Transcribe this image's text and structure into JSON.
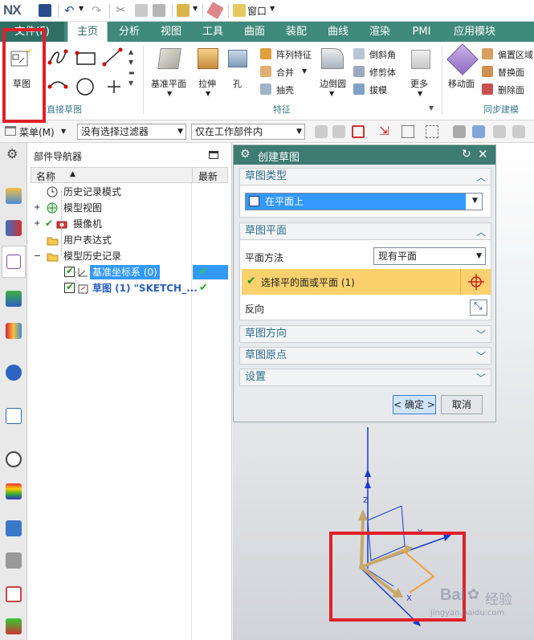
{
  "app": {
    "logo": "NX",
    "window_menu": "窗口"
  },
  "tabs": [
    "文件(F)",
    "主页",
    "分析",
    "视图",
    "工具",
    "曲面",
    "装配",
    "曲线",
    "渲染",
    "PMI",
    "应用模块"
  ],
  "ribbon": {
    "sketch": "草图",
    "direct_sketch_group": "直接草图",
    "datum_plane": "基准平面",
    "extrude": "拉伸",
    "hole": "孔",
    "pattern_feature": "阵列特征",
    "unite": "合并",
    "shell": "抽壳",
    "edge_blend": "边倒圆",
    "chamfer": "倒斜角",
    "trim_body": "修剪体",
    "draft": "拔模",
    "more": "更多",
    "feature_group": "特征",
    "move_face": "移动面",
    "offset_region": "偏置区域",
    "replace_face": "替换面",
    "delete_face": "删除面",
    "sync_group": "同步建模"
  },
  "cmdbar": {
    "menu": "菜单(M)",
    "filter": "没有选择过滤器",
    "scope": "仅在工作部件内"
  },
  "navigator": {
    "title": "部件导航器",
    "col_name": "名称",
    "col_latest": "最新",
    "rows": [
      {
        "label": "历史记录模式"
      },
      {
        "label": "模型视图"
      },
      {
        "label": "摄像机"
      },
      {
        "label": "用户表达式"
      },
      {
        "label": "模型历史记录"
      },
      {
        "label": "基准坐标系 (0)"
      },
      {
        "label": "草图 (1) \"SKETCH_..."
      }
    ]
  },
  "dialog": {
    "title": "创建草图",
    "sec_type": "草图类型",
    "type_value": "在平面上",
    "sec_plane": "草图平面",
    "plane_method_label": "平面方法",
    "plane_method_value": "现有平面",
    "select_plane": "选择平的面或平面 (1)",
    "reverse": "反向",
    "sec_orientation": "草图方向",
    "sec_origin": "草图原点",
    "sec_settings": "设置",
    "ok": "< 确定 >",
    "cancel": "取消"
  },
  "axes": {
    "z": "Z",
    "y": "Y",
    "x": "X"
  },
  "watermark": {
    "brand": "Bai",
    "suffix": "经验",
    "url": "jingyan.baidu.com"
  },
  "colors": {
    "accent": "#3f8a7a",
    "selection": "#3399ff",
    "highlight": "#fad16d",
    "annotation": "#e0202a",
    "axis": "#1a3ad0",
    "csys": "#c9a86a"
  }
}
